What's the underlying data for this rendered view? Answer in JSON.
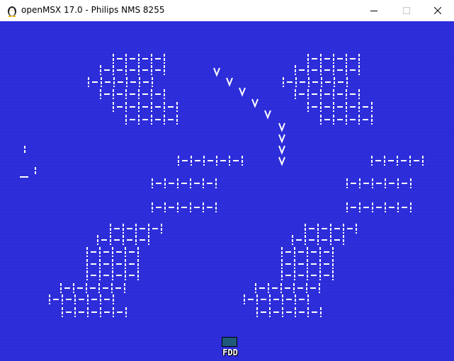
{
  "window": {
    "title": "openMSX 17.0 - Philips NMS 8255",
    "app_icon": "openmsx-penguin-icon",
    "controls": [
      "minimize-icon",
      "maximize-icon",
      "close-icon"
    ]
  },
  "screen": {
    "background_color": "#2b2be0",
    "foreground_color": "#ffffff"
  },
  "status": {
    "fdd_label": "FDD",
    "fdd_led_color": "#1f5a7a"
  }
}
